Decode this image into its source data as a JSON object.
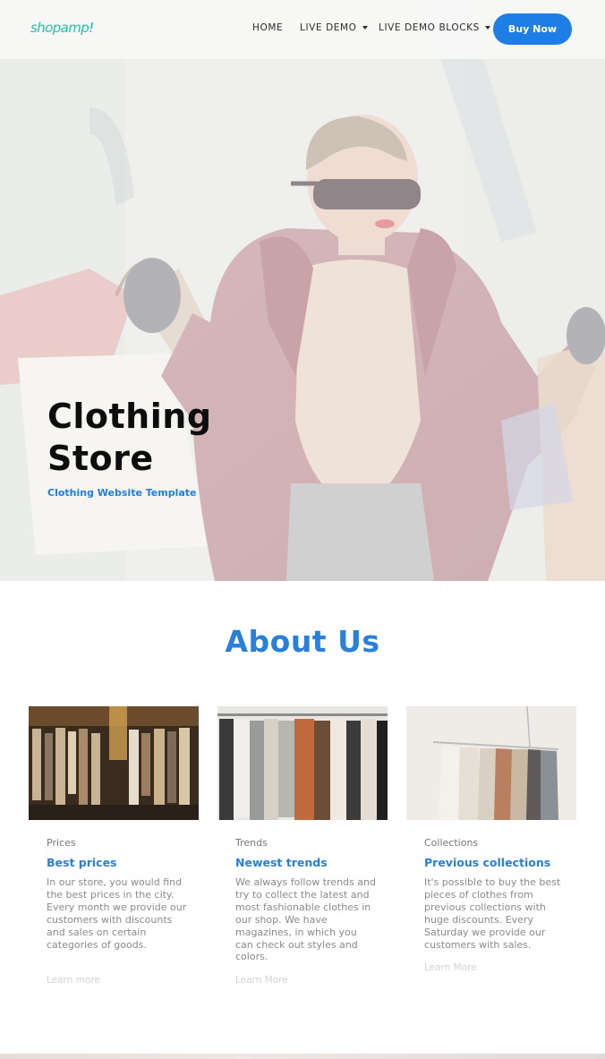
{
  "nav": {
    "logo": "shopamp!",
    "logo_main": "shopamp",
    "logo_mark": "!",
    "home": "HOME",
    "live_demo": "LIVE DEMO",
    "live_demo_blocks": "LIVE DEMO BLOCKS",
    "buy_now": "Buy Now",
    "icons": [
      "chevron-down-icon"
    ]
  },
  "hero": {
    "title": "Clothing Store",
    "subtitle": "Clothing Website Template",
    "image": "woman-with-shopping-bags"
  },
  "about": {
    "title": "About Us",
    "cards": [
      {
        "category": "Prices",
        "heading": "Best prices",
        "body": "In our store, you would find the best prices in the city. Every month we provide our customers with discounts and sales on certain categories of goods.",
        "link": "Learn more",
        "image": "clothes-rack-shop"
      },
      {
        "category": "Trends",
        "heading": "Newest trends",
        "body": "We always follow trends and try to collect the latest and most fashionable clothes in our shop. We have magazines, in which you can check out styles and colors.",
        "link": "Learn More",
        "image": "clothes-rack-colorful"
      },
      {
        "category": "Collections",
        "heading": "Previous collections",
        "body": "It's possible to buy the best pieces of clothes from previous collections with huge discounts. Every Saturday we provide our customers with sales.",
        "link": "Learn More",
        "image": "clothes-hanging-rack"
      }
    ]
  },
  "colors": {
    "accent": "#1f7ee6",
    "heading_blue": "#2a7fd8",
    "logo_green": "#23c0a4"
  }
}
